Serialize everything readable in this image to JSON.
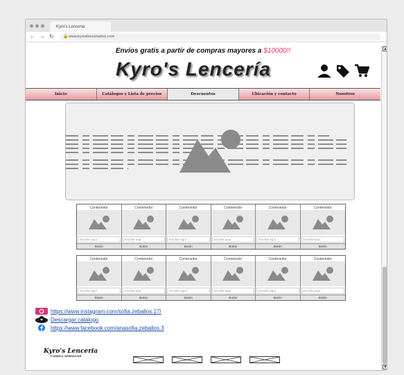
{
  "browser": {
    "tab_title": "Kyro's Lenceria",
    "url": "www.kyroslenceriaduc.com",
    "back": "←",
    "forward": "→",
    "reload": "↻"
  },
  "header": {
    "promo_text": "Envíos gratis a partir de compras mayores a ",
    "promo_amount": "$10000!!",
    "brand": "Kyro's Lencería"
  },
  "nav": {
    "items": [
      {
        "label": "Inicio"
      },
      {
        "label": "Catálogos y Lista de precios"
      },
      {
        "label": "Descuentos"
      },
      {
        "label": "Ubicación y contacto"
      },
      {
        "label": "Nosotros"
      }
    ],
    "active_index": 2
  },
  "products_row1": [
    {
      "title": "Contenedor",
      "placeholder": "Escribe aquí",
      "button": "Botón"
    },
    {
      "title": "Contenedor",
      "placeholder": "Escribe aquí",
      "button": "Botón"
    },
    {
      "title": "Contenedor",
      "placeholder": "Escribe aquí",
      "button": "Botón"
    },
    {
      "title": "Contenedor",
      "placeholder": "Escribe aquí",
      "button": "Botón"
    },
    {
      "title": "Contenedor",
      "placeholder": "Escribe aquí",
      "button": "Botón"
    },
    {
      "title": "Contenedor",
      "placeholder": "Escribe aquí",
      "button": "Botón"
    }
  ],
  "products_row2": [
    {
      "title": "Contenedor",
      "placeholder": "Escribe aquí",
      "button": "Botón"
    },
    {
      "title": "Contenedor",
      "placeholder": "Escribe aquí",
      "button": "Botón"
    },
    {
      "title": "Contenedor",
      "placeholder": "Escribe aquí",
      "button": "Botón"
    },
    {
      "title": "Contenedor",
      "placeholder": "Escribe aquí",
      "button": "Botón"
    },
    {
      "title": "Contenedor",
      "placeholder": "Escribe aquí",
      "button": "Botón"
    },
    {
      "title": "Contenedor",
      "placeholder": "Escribe aquí",
      "button": "Botón"
    }
  ],
  "links": {
    "instagram": "https://www.instagram.com/sofia.zeballos.17/",
    "catalog": "Descargar catálogo",
    "facebook": "https://www.facebook.com/anasofia.zeballos.3"
  },
  "footer": {
    "logo": "Kyro's Lenceria",
    "logo_sub": "CAMILA ZEBALLOS"
  },
  "colors": {
    "accent": "#e8336a",
    "nav_pink": "#e79a9f",
    "link": "#1a4ba8"
  }
}
